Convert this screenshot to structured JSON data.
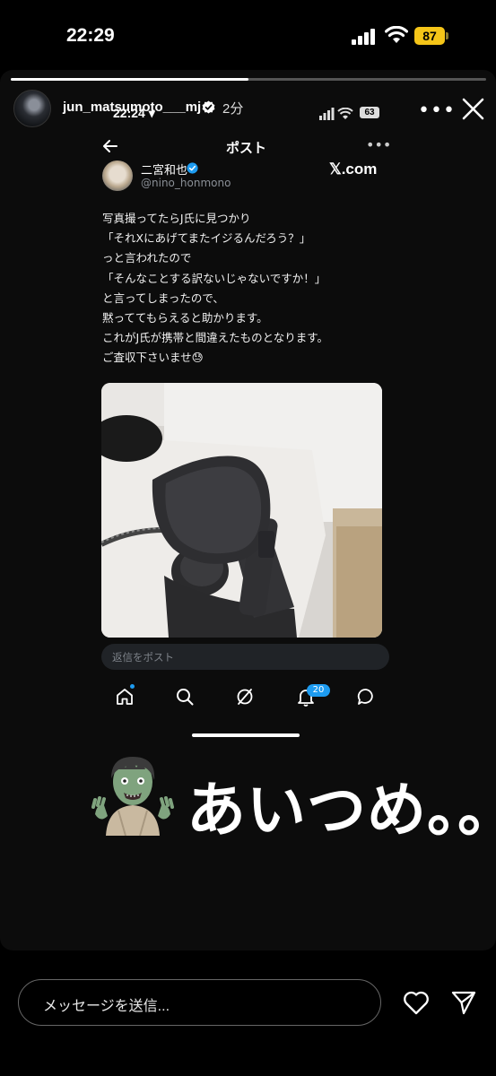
{
  "status_bar": {
    "time": "22:29",
    "battery": "87"
  },
  "story": {
    "progress": 0.5,
    "username": "jun_matsumoto___mj",
    "time_ago": "2分",
    "more_label": "•••"
  },
  "embedded_post": {
    "status_time": "22:24",
    "battery": "63",
    "header_title": "ポスト",
    "author_name": "二宮和也",
    "author_handle": "@nino_honmono",
    "watermark": "𝕏.com",
    "text": "写真撮ってたらJ氏に見つかり\n「それXにあげてまたイジるんだろう？」\nっと言われたので\n「そんなことする訳ないじゃないですか！」\nと言ってしまったので、\n黙っててもらえると助かります。\nこれがJ氏が携帯と間違えたものとなります。\nご査収下さいませ😓",
    "reply_placeholder": "返信をポスト",
    "notification_count": "20",
    "nav_icons": [
      "home-icon",
      "search-icon",
      "grok-icon",
      "notifications-icon",
      "messages-icon"
    ]
  },
  "sticker": {
    "emoji": "🧟",
    "caption": "あいつめ。。"
  },
  "message_bar": {
    "placeholder": "メッセージを送信...",
    "icons": [
      "heart-icon",
      "send-icon"
    ]
  }
}
